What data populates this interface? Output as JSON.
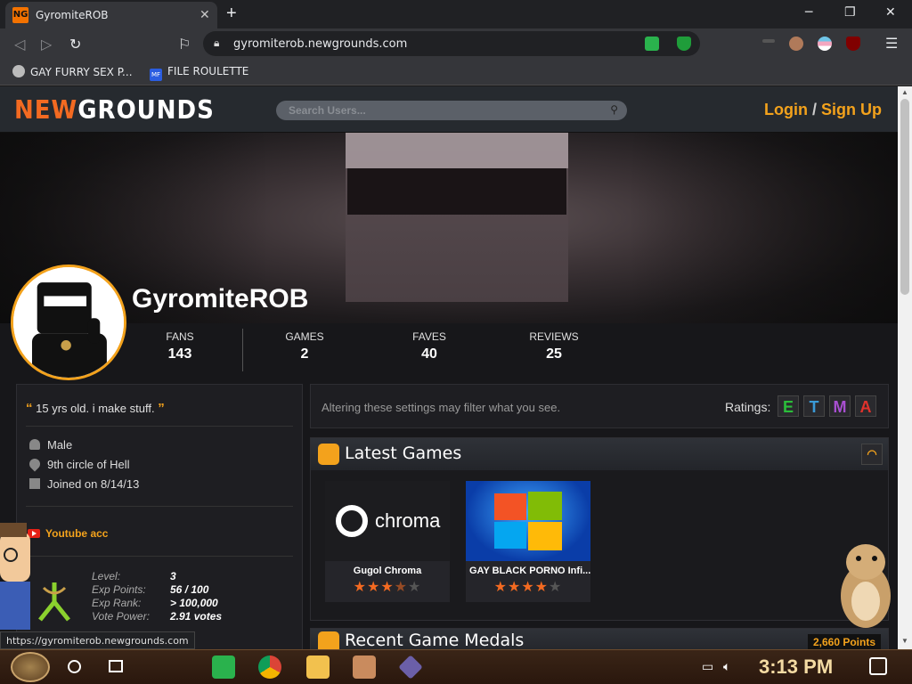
{
  "browser": {
    "tab_title": "GyromiteROB",
    "tab_favicon": "NG",
    "url": "gyromiterob.newgrounds.com",
    "bookmarks": [
      {
        "label": "GAY FURRY SEX P...",
        "icon": "globe-icon"
      },
      {
        "label": "FILE ROULETTE",
        "icon": "file-roulette-icon"
      }
    ],
    "status_url": "https://gyromiterob.newgrounds.com"
  },
  "header": {
    "logo_new": "NEW",
    "logo_grounds": "GROUNDS",
    "search_placeholder": "Search Users...",
    "login": "Login",
    "separator": "/",
    "signup": "Sign Up"
  },
  "profile": {
    "username": "GyromiteROB",
    "stats": [
      {
        "label": "FANS",
        "value": "143"
      },
      {
        "label": "GAMES",
        "value": "2"
      },
      {
        "label": "FAVES",
        "value": "40"
      },
      {
        "label": "REVIEWS",
        "value": "25"
      }
    ],
    "quote": "15 yrs old. i make stuff.",
    "gender": "Male",
    "location": "9th circle of Hell",
    "joined": "Joined on 8/14/13",
    "link": "Youtube acc",
    "level": {
      "level_label": "Level:",
      "level_value": "3",
      "exp_label": "Exp Points:",
      "exp_value": "56 / 100",
      "rank_label": "Exp Rank:",
      "rank_value": "> 100,000",
      "vote_label": "Vote Power:",
      "vote_value": "2.91 votes"
    }
  },
  "filter": {
    "text": "Altering these settings may filter what you see.",
    "ratings_label": "Ratings:",
    "ratings": [
      {
        "letter": "E",
        "color": "#2bbd3a"
      },
      {
        "letter": "T",
        "color": "#3a9ad6"
      },
      {
        "letter": "M",
        "color": "#a84fd1"
      },
      {
        "letter": "A",
        "color": "#e0322c"
      }
    ]
  },
  "games": {
    "title": "Latest Games",
    "items": [
      {
        "title": "Gugol Chroma",
        "thumb_text": "chroma",
        "stars": 3.5
      },
      {
        "title": "GAY BLACK PORNO Infi...",
        "thumb_text": "",
        "stars": 4
      }
    ]
  },
  "medals": {
    "title": "Recent Game Medals",
    "points": "2,660 Points"
  },
  "taskbar": {
    "clock": "3:13 PM"
  }
}
